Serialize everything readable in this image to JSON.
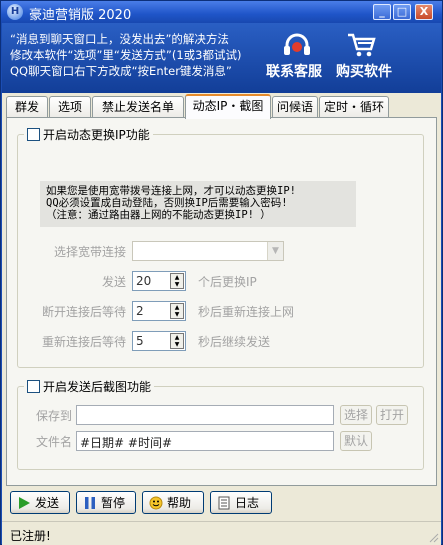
{
  "window": {
    "title": "豪迪营销版 2020",
    "app_icon_letter": "H"
  },
  "title_buttons": {
    "minimize": "_",
    "maximize": "□",
    "close": "X"
  },
  "banner": {
    "line1": "“消息到聊天窗口上，没发出去”的解决方法",
    "line2": "修改本软件“选项”里“发送方式”(1或3都试试)",
    "line3": "QQ聊天窗口右下方改成“按Enter键发消息”",
    "customer_service": "联系客服",
    "buy": "购买软件"
  },
  "tabs": [
    {
      "label": "群发"
    },
    {
      "label": "选项"
    },
    {
      "label": "禁止发送名单"
    },
    {
      "label": "动态IP・截图",
      "active": true
    },
    {
      "label": "问候语"
    },
    {
      "label": "定时・循环"
    }
  ],
  "dynamic_ip": {
    "legend": "开启动态更换IP功能",
    "notice": "如果您是使用宽带拨号连接上网，才可以动态更换IP!\nQQ必须设置成自动登陆，否则换IP后需要输入密码!\n（注意：通过路由器上网的不能动态更换IP! ）",
    "select_label": "选择宽带连接",
    "select_value": "",
    "send_label": "发送",
    "send_value": "20",
    "send_suffix": "个后更换IP",
    "disconnect_label": "断开连接后等待",
    "disconnect_value": "2",
    "disconnect_suffix": "秒后重新连接上网",
    "reconnect_label": "重新连接后等待",
    "reconnect_value": "5",
    "reconnect_suffix": "秒后继续发送"
  },
  "screenshot": {
    "legend": "开启发送后截图功能",
    "save_label": "保存到",
    "save_value": "",
    "choose_button": "选择",
    "open_button": "打开",
    "filename_label": "文件名",
    "filename_value": "#日期# #时间#",
    "default_button": "默认"
  },
  "actions": {
    "send": "发送",
    "pause": "暂停",
    "help": "帮助",
    "log": "日志"
  },
  "status": {
    "text": "已注册!"
  },
  "colors": {
    "title_bar": "#1f55c8",
    "banner": "#1b4db3",
    "tab_active_accent": "#e68b2c",
    "panel": "#f6f6f2"
  }
}
